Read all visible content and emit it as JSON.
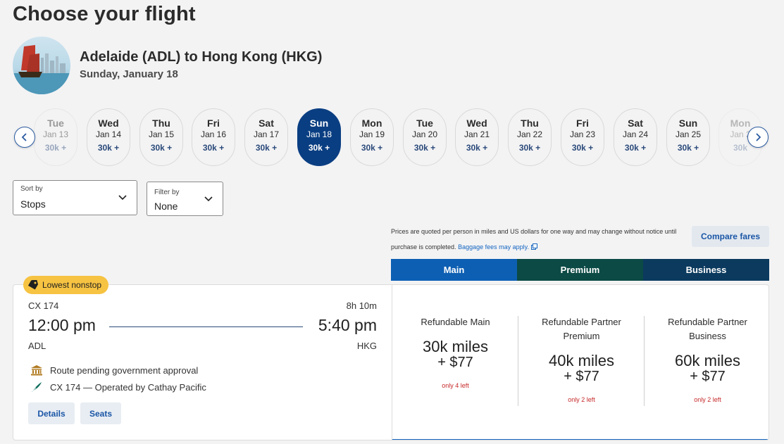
{
  "page_title": "Choose your flight",
  "route": {
    "title": "Adelaide (ADL) to Hong Kong (HKG)",
    "date": "Sunday, January 18"
  },
  "dates": [
    {
      "dow": "Tue",
      "dm": "Jan 13",
      "price": "30k +"
    },
    {
      "dow": "Wed",
      "dm": "Jan 14",
      "price": "30k +"
    },
    {
      "dow": "Thu",
      "dm": "Jan 15",
      "price": "30k +"
    },
    {
      "dow": "Fri",
      "dm": "Jan 16",
      "price": "30k +"
    },
    {
      "dow": "Sat",
      "dm": "Jan 17",
      "price": "30k +"
    },
    {
      "dow": "Sun",
      "dm": "Jan 18",
      "price": "30k +"
    },
    {
      "dow": "Mon",
      "dm": "Jan 19",
      "price": "30k +"
    },
    {
      "dow": "Tue",
      "dm": "Jan 20",
      "price": "30k +"
    },
    {
      "dow": "Wed",
      "dm": "Jan 21",
      "price": "30k +"
    },
    {
      "dow": "Thu",
      "dm": "Jan 22",
      "price": "30k +"
    },
    {
      "dow": "Fri",
      "dm": "Jan 23",
      "price": "30k +"
    },
    {
      "dow": "Sat",
      "dm": "Jan 24",
      "price": "30k +"
    },
    {
      "dow": "Sun",
      "dm": "Jan 25",
      "price": "30k +"
    },
    {
      "dow": "Mon",
      "dm": "Jan 2",
      "price": "30k"
    }
  ],
  "selected_date_index": 5,
  "sort": {
    "label": "Sort by",
    "value": "Stops"
  },
  "filter": {
    "label": "Filter by",
    "value": "None"
  },
  "notice": {
    "text": "Prices are quoted per person in miles and US dollars for one way and may change without notice until purchase is completed.",
    "link": "Baggage fees may apply."
  },
  "compare_label": "Compare fares",
  "cabin_tabs": [
    {
      "label": "Main",
      "color": "#0d5fb3"
    },
    {
      "label": "Premium",
      "color": "#0c4a45"
    },
    {
      "label": "Business",
      "color": "#0b3a5e"
    }
  ],
  "flight": {
    "badge": "Lowest nonstop",
    "number": "CX 174",
    "duration": "8h 10m",
    "depart_time": "12:00 pm",
    "arrive_time": "5:40 pm",
    "depart_code": "ADL",
    "arrive_code": "HKG",
    "note1": "Route pending government approval",
    "note2": "CX 174 — Operated by Cathay Pacific",
    "details_label": "Details",
    "seats_label": "Seats",
    "fares": [
      {
        "name": "Refundable Main",
        "miles": "30k miles",
        "cash": "+ $77",
        "seats": "only 4 left"
      },
      {
        "name": "Refundable Partner Premium",
        "miles": "40k miles",
        "cash": "+ $77",
        "seats": "only 2 left"
      },
      {
        "name": "Refundable Partner Business",
        "miles": "60k miles",
        "cash": "+ $77",
        "seats": "only 2 left"
      }
    ]
  }
}
